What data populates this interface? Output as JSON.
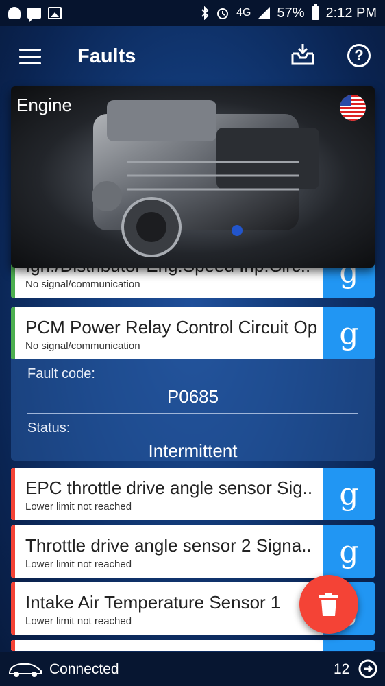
{
  "status_bar": {
    "network": "4G",
    "battery": "57%",
    "time": "2:12 PM",
    "icons": [
      "snapchat-icon",
      "chat-icon",
      "photo-icon",
      "bluetooth-icon",
      "alarm-icon",
      "signal-icon",
      "battery-icon"
    ]
  },
  "app_bar": {
    "title": "Faults",
    "icons": [
      "menu-icon",
      "inbox-download-icon",
      "help-icon"
    ]
  },
  "header_card": {
    "title": "Engine",
    "flag": "us-flag-icon"
  },
  "faults": [
    {
      "title": "Ign./Distributor Eng.Speed Inp.Circ..",
      "subtitle": "No signal/communication",
      "severity": "green"
    },
    {
      "title": "PCM Power Relay Control Circuit Op",
      "subtitle": "No signal/communication",
      "severity": "green"
    },
    {
      "title": "EPC throttle drive angle sensor Sig..",
      "subtitle": "Lower limit not reached",
      "severity": "red"
    },
    {
      "title": "Throttle drive angle sensor 2 Signa..",
      "subtitle": "Lower limit not reached",
      "severity": "red"
    },
    {
      "title": "Intake Air Temperature Sensor 1",
      "subtitle": "Lower limit not reached",
      "severity": "red"
    }
  ],
  "details": {
    "fault_code_label": "Fault code:",
    "fault_code": "P0685",
    "status_label": "Status:",
    "status": "Intermittent"
  },
  "google_label": "g",
  "bottom_bar": {
    "connection": "Connected",
    "count": "12"
  },
  "colors": {
    "accent_blue": "#2196f3",
    "fab_red": "#f44336",
    "severity_green": "#4caf50",
    "severity_red": "#f44336"
  }
}
